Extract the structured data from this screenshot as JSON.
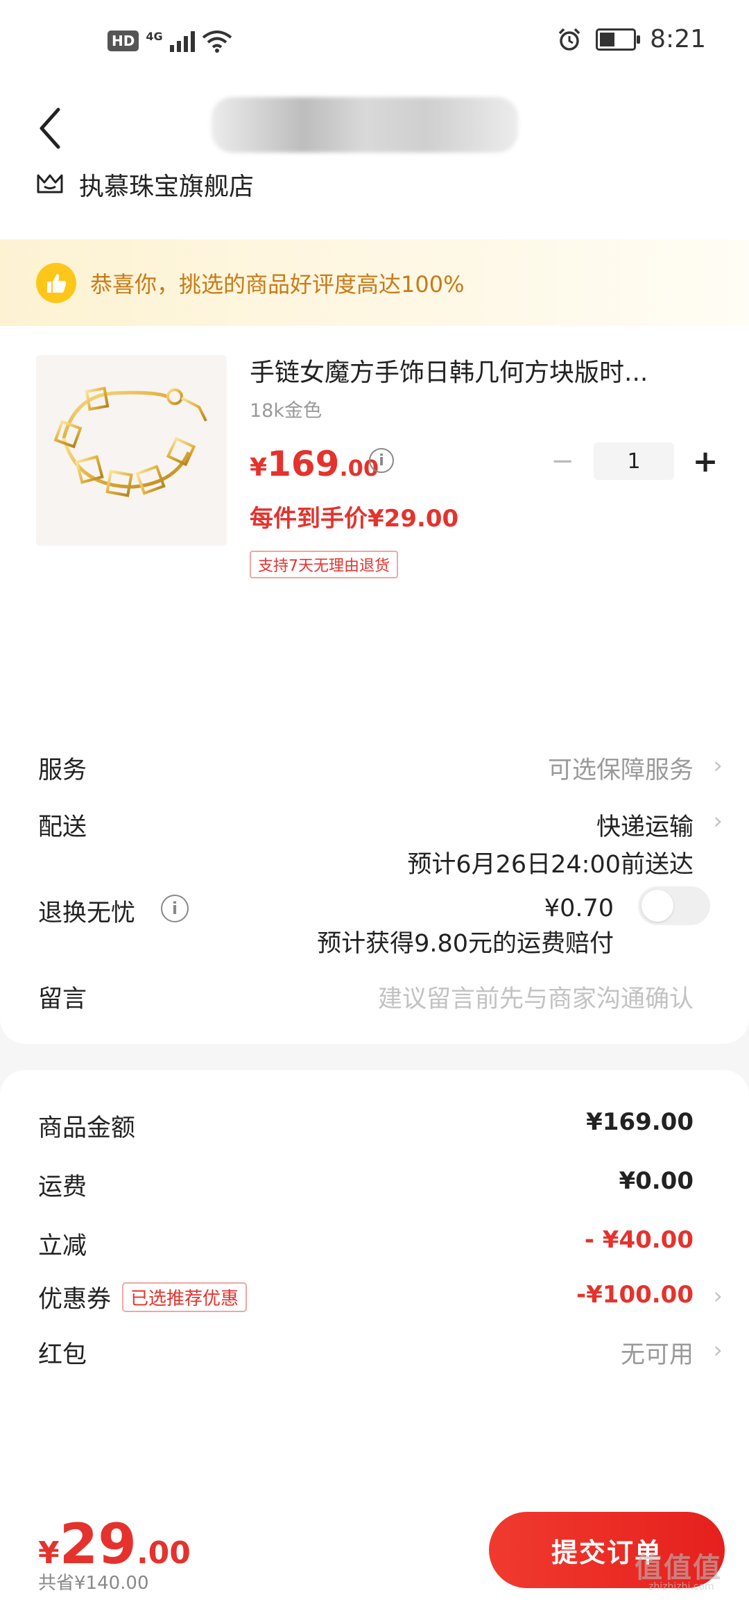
{
  "status_bar": {
    "hd": "HD",
    "network": "4G",
    "time": "8:21",
    "battery_level": 0.45
  },
  "header": {
    "store_name": "执慕珠宝旗舰店",
    "icons": {
      "back": "chevron-left-icon",
      "store": "store-crown-icon"
    }
  },
  "praise": {
    "text": "恭喜你，挑选的商品好评度高达100%",
    "icon": "thumbs-up-icon"
  },
  "product": {
    "title": "手链女魔方手饰日韩几何方块版时...",
    "spec": "18k金色",
    "price_currency": "¥",
    "price_int": "169",
    "price_dec": ".00",
    "per_price": "每件到手价¥29.00",
    "return_tag": "支持7天无理由退货",
    "quantity": "1",
    "minus": "−",
    "plus": "+"
  },
  "rows": {
    "service": {
      "label": "服务",
      "value": "可选保障服务"
    },
    "delivery": {
      "label": "配送",
      "value": "快递运输",
      "eta": "预计6月26日24:00前送达"
    },
    "returns": {
      "label": "退换无忧",
      "price": "¥0.70",
      "note": "预计获得9.80元的运费赔付",
      "enabled": false
    },
    "message": {
      "label": "留言",
      "placeholder": "建议留言前先与商家沟通确认"
    }
  },
  "summary": {
    "goods": {
      "label": "商品金额",
      "value": "¥169.00"
    },
    "shipping": {
      "label": "运费",
      "value": "¥0.00"
    },
    "discount": {
      "label": "立减",
      "value": "- ¥40.00"
    },
    "coupon": {
      "label": "优惠券",
      "tag": "已选推荐优惠",
      "value": "-¥100.00"
    },
    "redpacket": {
      "label": "红包",
      "value": "无可用"
    }
  },
  "bottom": {
    "total_currency": "¥",
    "total_int": "29",
    "total_dec": ".00",
    "saved": "共省¥140.00",
    "submit": "提交订单",
    "watermark": "值值值",
    "watermark_url": "zhizhizhi.com"
  },
  "colors": {
    "accent": "#e5322d",
    "praise_text": "#c97a16",
    "praise_icon": "#ffc61a"
  }
}
